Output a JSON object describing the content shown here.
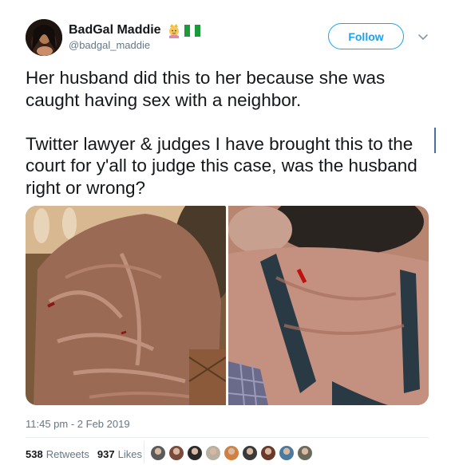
{
  "author": {
    "display_name": "BadGal Maddie",
    "handle": "@badgal_maddie",
    "emoji_icons": [
      "princess-emoji-icon",
      "nigeria-flag-icon"
    ]
  },
  "follow_label": "Follow",
  "tweet_text": "Her husband did this to her because she was caught having sex with a neighbor.\n\nTwitter lawyer & judges I have brought this to the court for y'all to judge this case, was the husband right or wrong?",
  "media": {
    "photo_count": 2
  },
  "timestamp": "11:45 pm - 2 Feb 2019",
  "stats": {
    "retweets_count": "538",
    "retweets_label": "Retweets",
    "likes_count": "937",
    "likes_label": "Likes"
  },
  "liker_avatars": [
    "#5a5a5a",
    "#7a4a3a",
    "#2a2a2a",
    "#b8b0a0",
    "#d08040",
    "#3a3a3a",
    "#6a3a2a",
    "#4a7aa0",
    "#6a6a5a"
  ],
  "colors": {
    "accent": "#1da1f2",
    "muted": "#657786",
    "text": "#14171a"
  }
}
